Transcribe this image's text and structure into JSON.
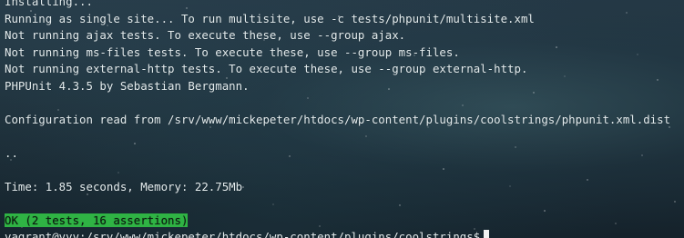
{
  "terminal": {
    "lines": [
      "Installing...",
      "Running as single site... To run multisite, use -c tests/phpunit/multisite.xml",
      "Not running ajax tests. To execute these, use --group ajax.",
      "Not running ms-files tests. To execute these, use --group ms-files.",
      "Not running external-http tests. To execute these, use --group external-http.",
      "PHPUnit 4.3.5 by Sebastian Bergmann.",
      "",
      "Configuration read from /srv/www/mickepeter/htdocs/wp-content/plugins/coolstrings/phpunit.xml.dist",
      "",
      "..",
      "",
      "Time: 1.85 seconds, Memory: 22.75Mb",
      ""
    ],
    "result": "OK (2 tests, 16 assertions)",
    "prompt": "vagrant@vvv:/srv/www/mickepeter/htdocs/wp-content/plugins/coolstrings$"
  },
  "colors": {
    "background": "#1d2e38",
    "text": "#e4ecee",
    "ok_badge": "#2fb344",
    "cursor": "#f2f2f2"
  }
}
